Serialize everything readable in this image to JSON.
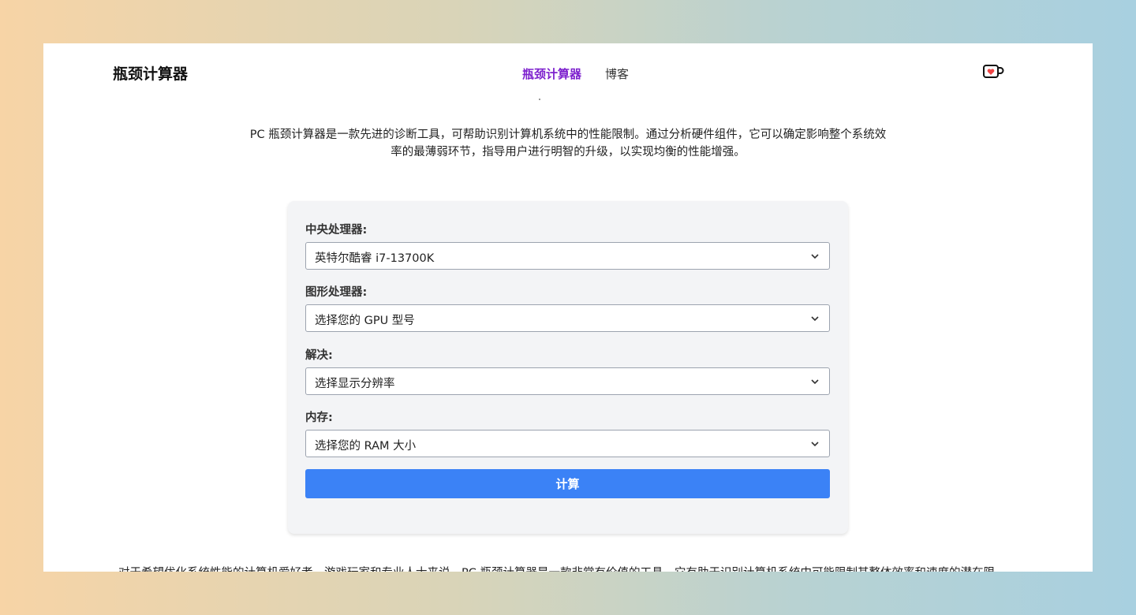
{
  "navbar": {
    "brand": "瓶颈计算器",
    "links": [
      {
        "label": "瓶颈计算器",
        "active": true
      },
      {
        "label": "博客",
        "active": false
      }
    ],
    "kofi_icon": "coffee-cup-heart-icon"
  },
  "intro": {
    "line1": "PC 瓶颈计算器是一款先进的诊断工具，可帮助识别计算机系统中的性能限制。通过分析硬件组件，它可以确定影响整个系统效",
    "line2": "率的最薄弱环节，指导用户进行明智的升级，以实现均衡的性能增强。"
  },
  "form": {
    "fields": [
      {
        "label": "中央处理器:",
        "value": "英特尔酷睿 i7-13700K"
      },
      {
        "label": "图形处理器:",
        "value": "选择您的 GPU 型号"
      },
      {
        "label": "解决:",
        "value": "选择显示分辨率"
      },
      {
        "label": "内存:",
        "value": "选择您的 RAM 大小"
      }
    ],
    "submit_label": "计算"
  },
  "footer_text": "对于希望优化系统性能的计算机爱好者、游戏玩家和专业人士来说，PC 瓶颈计算器是一款非常有价值的工具。它有助于识别计算机系统中可能限制其整体效率和速度的潜在限",
  "colors": {
    "accent": "#7e22ce",
    "button": "#3b82f6",
    "card_bg": "#f3f4f6"
  }
}
